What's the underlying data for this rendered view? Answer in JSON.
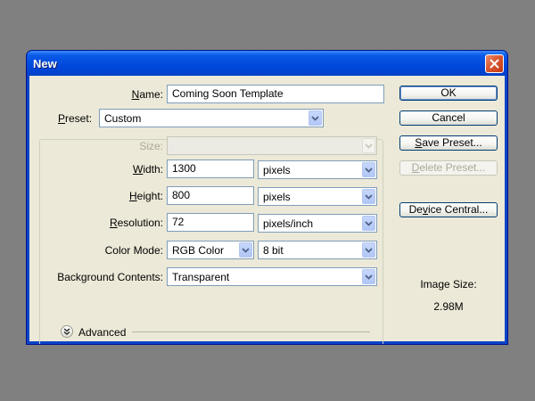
{
  "window": {
    "title": "New"
  },
  "form": {
    "name": {
      "label": "Name:",
      "mnemonic": "N",
      "label_rest": "ame:",
      "value": "Coming Soon Template"
    },
    "preset": {
      "mnemonic": "P",
      "label_rest": "reset:",
      "value": "Custom"
    },
    "size": {
      "label": "Size:",
      "value": ""
    },
    "width": {
      "mnemonic": "W",
      "label_rest": "idth:",
      "value": "1300",
      "unit": "pixels"
    },
    "height": {
      "mnemonic": "H",
      "label_rest": "eight:",
      "value": "800",
      "unit": "pixels"
    },
    "resolution": {
      "mnemonic": "R",
      "label_rest": "esolution:",
      "value": "72",
      "unit": "pixels/inch"
    },
    "color_mode": {
      "label": "Color Mode:",
      "value": "RGB Color",
      "depth": "8 bit"
    },
    "background": {
      "label": "Background Contents:",
      "value": "Transparent"
    },
    "advanced": {
      "label": "Advanced"
    }
  },
  "buttons": {
    "ok": "OK",
    "cancel": "Cancel",
    "save_mnemonic": "S",
    "save_rest": "ave Preset...",
    "delete_mnemonic": "D",
    "delete_rest": "elete Preset...",
    "device_pre": "De",
    "device_mnemonic": "v",
    "device_rest": "ice Central..."
  },
  "image_size": {
    "label": "Image Size:",
    "value": "2.98M"
  },
  "colors": {
    "title_bar": "#0048dc",
    "dialog_bg": "#ece9d8",
    "close_button": "#d9542c"
  }
}
